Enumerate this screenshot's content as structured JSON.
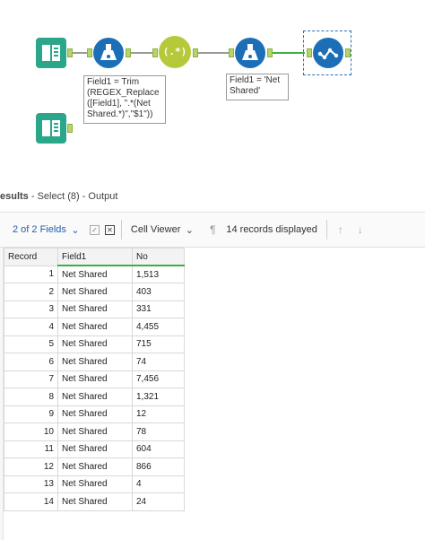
{
  "canvas": {
    "annotations": {
      "formula1": "Field1 = Trim\n(REGEX_Replace\n([Field1], \".*(Net\nShared.*)\",\"$1\"))",
      "formula2": "Field1 = 'Net\nShared'"
    },
    "regex_tool_symbol": "(.*)"
  },
  "results": {
    "title_prefix": "esults",
    "title_rest": " - Select (8) - Output",
    "fields_selector": "2 of 2 Fields",
    "cell_viewer": "Cell Viewer",
    "records_displayed": "14 records displayed",
    "columns": [
      "Record",
      "Field1",
      "No"
    ],
    "rows": [
      [
        "1",
        "Net Shared",
        "1,513"
      ],
      [
        "2",
        "Net Shared",
        "403"
      ],
      [
        "3",
        "Net Shared",
        "331"
      ],
      [
        "4",
        "Net Shared",
        "4,455"
      ],
      [
        "5",
        "Net Shared",
        "715"
      ],
      [
        "6",
        "Net Shared",
        "74"
      ],
      [
        "7",
        "Net Shared",
        "7,456"
      ],
      [
        "8",
        "Net Shared",
        "1,321"
      ],
      [
        "9",
        "Net Shared",
        "12"
      ],
      [
        "10",
        "Net Shared",
        "78"
      ],
      [
        "11",
        "Net Shared",
        "604"
      ],
      [
        "12",
        "Net Shared",
        "866"
      ],
      [
        "13",
        "Net Shared",
        "4"
      ],
      [
        "14",
        "Net Shared",
        "24"
      ]
    ]
  },
  "colors": {
    "input_tool": "#2aa68a",
    "formula_tool": "#1c6fb7",
    "regex_tool": "#b6c93a",
    "select_tool": "#1c6fb7",
    "connection_active": "#3fae49"
  },
  "icons": {
    "input": "book-icon",
    "formula": "flask-icon",
    "regex": "regex-icon",
    "select": "checkmark-chain-icon"
  }
}
